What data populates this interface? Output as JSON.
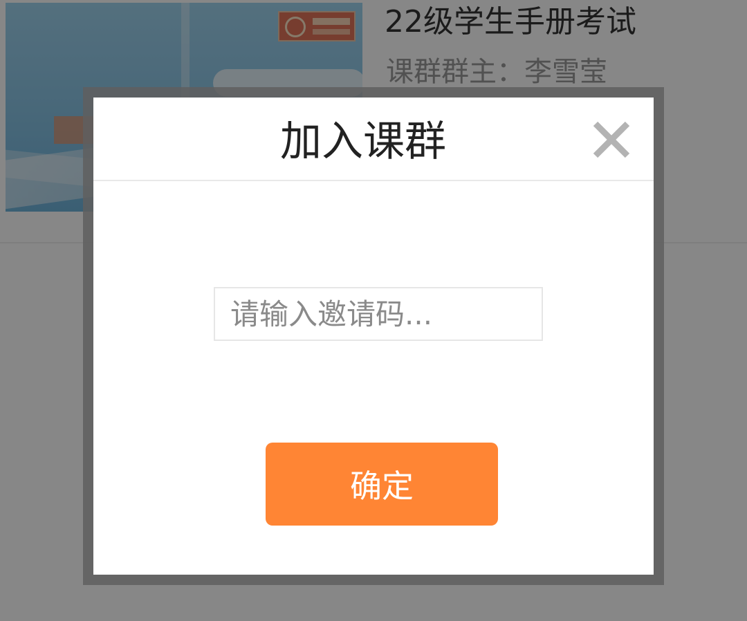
{
  "course": {
    "title": "22级学生手册考试",
    "owner": "课群群主：李雪莹",
    "cover_icon": "course-cover-image"
  },
  "dialog": {
    "title": "加入课群",
    "close_icon": "close-icon",
    "invite_input": {
      "value": "",
      "placeholder": "请输入邀请码..."
    },
    "confirm_label": "确定"
  },
  "colors": {
    "accent": "#ff8534",
    "overlay": "rgba(0,0,0,0.47)",
    "dialog_bg": "#ffffff"
  }
}
